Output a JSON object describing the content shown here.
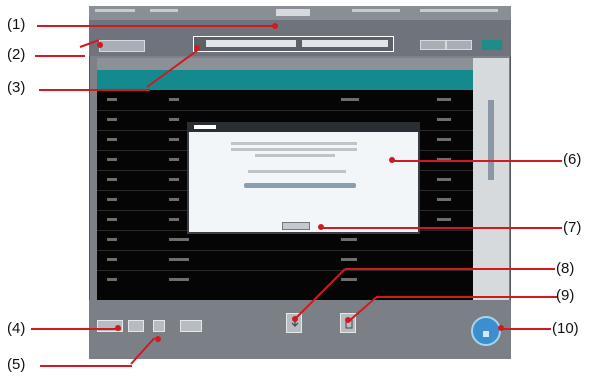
{
  "callouts": {
    "c1": "(1)",
    "c2": "(2)",
    "c3": "(3)",
    "c4": "(4)",
    "c5": "(5)",
    "c6": "(6)",
    "c7": "(7)",
    "c8": "(8)",
    "c9": "(9)",
    "c10": "(10)"
  },
  "colors": {
    "callout_line": "#d01a20",
    "list_background": "#050505",
    "header_accent": "#148a8e",
    "round_button": "#3b8fcf"
  },
  "icons": {
    "tool_8": "download-icon",
    "tool_9": "document-icon",
    "tool_10": "circle-button-icon"
  }
}
